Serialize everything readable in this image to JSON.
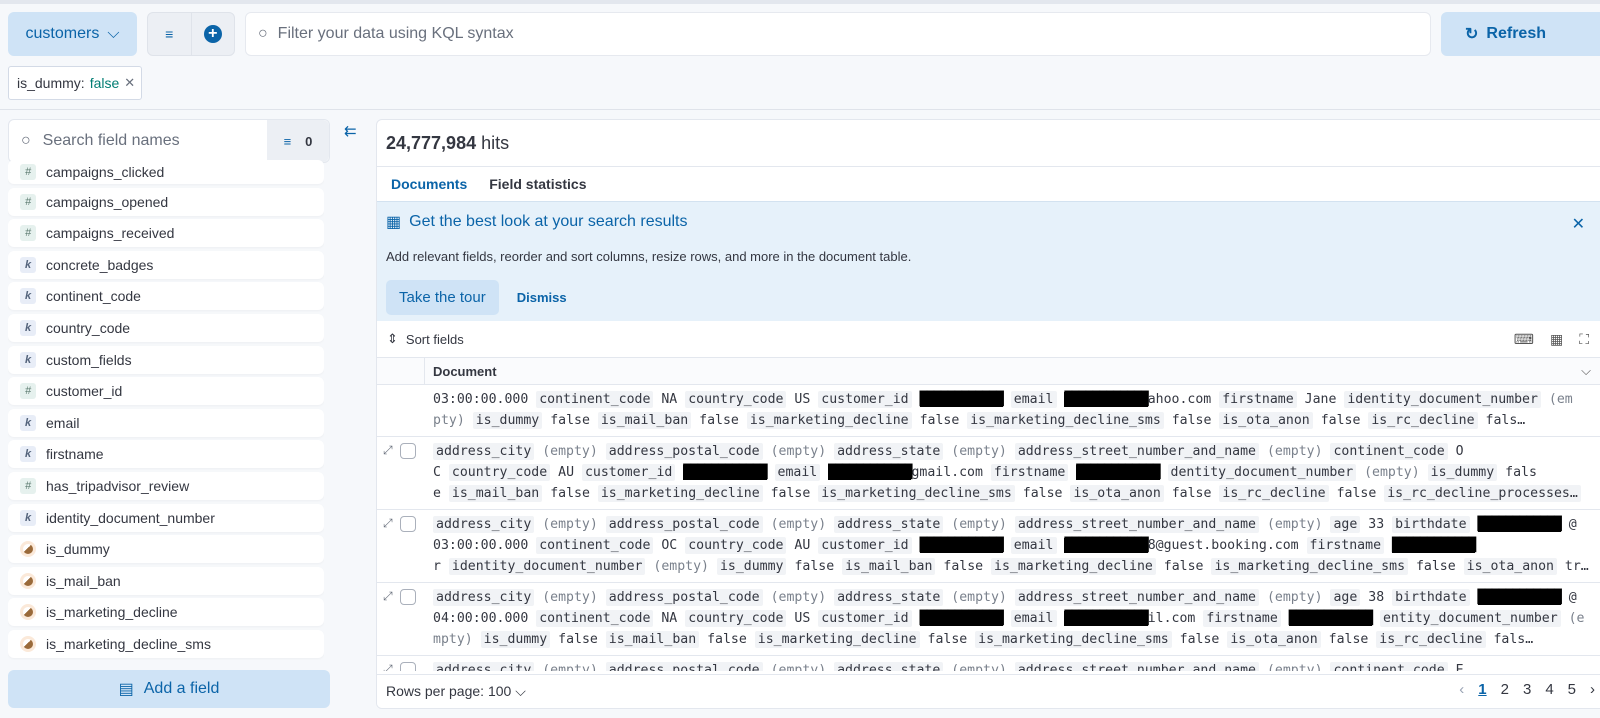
{
  "top": {
    "index_label": "customers",
    "kql_placeholder": "Filter your data using KQL syntax",
    "refresh_label": "Refresh"
  },
  "filter_pill": {
    "field": "is_dummy:",
    "value": "false"
  },
  "sidebar": {
    "search_placeholder": "Search field names",
    "filter_count": "0",
    "fields": [
      {
        "type": "number",
        "name": "campaigns_clicked"
      },
      {
        "type": "number",
        "name": "campaigns_opened"
      },
      {
        "type": "number",
        "name": "campaigns_received"
      },
      {
        "type": "keyword",
        "name": "concrete_badges"
      },
      {
        "type": "keyword",
        "name": "continent_code"
      },
      {
        "type": "keyword",
        "name": "country_code"
      },
      {
        "type": "keyword",
        "name": "custom_fields"
      },
      {
        "type": "number",
        "name": "customer_id"
      },
      {
        "type": "keyword",
        "name": "email"
      },
      {
        "type": "keyword",
        "name": "firstname"
      },
      {
        "type": "number",
        "name": "has_tripadvisor_review"
      },
      {
        "type": "keyword",
        "name": "identity_document_number"
      },
      {
        "type": "boolean",
        "name": "is_dummy"
      },
      {
        "type": "boolean",
        "name": "is_mail_ban"
      },
      {
        "type": "boolean",
        "name": "is_marketing_decline"
      },
      {
        "type": "boolean",
        "name": "is_marketing_decline_sms"
      }
    ],
    "add_field_label": "Add a field"
  },
  "main": {
    "hits_count": "24,777,984",
    "hits_label": "hits",
    "tabs": [
      "Documents",
      "Field statistics"
    ],
    "callout": {
      "title": "Get the best look at your search results",
      "text": "Add relevant fields, reorder and sort columns, resize rows, and more in the document table.",
      "tour_label": "Take the tour",
      "dismiss_label": "Dismiss"
    },
    "sort_label": "Sort fields",
    "column_header": "Document",
    "rows": [
      {
        "controls": false,
        "lines": [
          [
            [
              "v",
              "03:00:00.000"
            ],
            [
              "k",
              "continent_code"
            ],
            [
              "v",
              "NA"
            ],
            [
              "k",
              "country_code"
            ],
            [
              "v",
              "US"
            ],
            [
              "k",
              "customer_id"
            ],
            [
              "r",
              "████████████"
            ],
            [
              "k",
              "email"
            ],
            [
              "r",
              "████████████"
            ],
            [
              "v",
              "ahoo.com"
            ],
            [
              "k",
              "firstname"
            ],
            [
              "v",
              "Jane"
            ],
            [
              "k",
              "identity_document_number"
            ],
            [
              "e",
              "(em"
            ]
          ],
          [
            [
              "e",
              "pty)"
            ],
            [
              "k",
              "is_dummy"
            ],
            [
              "v",
              "false"
            ],
            [
              "k",
              "is_mail_ban"
            ],
            [
              "v",
              "false"
            ],
            [
              "k",
              "is_marketing_decline"
            ],
            [
              "v",
              "false"
            ],
            [
              "k",
              "is_marketing_decline_sms"
            ],
            [
              "v",
              "false"
            ],
            [
              "k",
              "is_ota_anon"
            ],
            [
              "v",
              "false"
            ],
            [
              "k",
              "is_rc_decline"
            ],
            [
              "v",
              "fals…"
            ]
          ]
        ]
      },
      {
        "controls": true,
        "lines": [
          [
            [
              "k",
              "address_city"
            ],
            [
              "e",
              "(empty)"
            ],
            [
              "k",
              "address_postal_code"
            ],
            [
              "e",
              "(empty)"
            ],
            [
              "k",
              "address_state"
            ],
            [
              "e",
              "(empty)"
            ],
            [
              "k",
              "address_street_number_and_name"
            ],
            [
              "e",
              "(empty)"
            ],
            [
              "k",
              "continent_code"
            ],
            [
              "v",
              "O"
            ]
          ],
          [
            [
              "v",
              "C"
            ],
            [
              "k",
              "country_code"
            ],
            [
              "v",
              "AU"
            ],
            [
              "k",
              "customer_id"
            ],
            [
              "r",
              "████████████"
            ],
            [
              "k",
              "email"
            ],
            [
              "r",
              "████████████"
            ],
            [
              "v",
              "gmail.com"
            ],
            [
              "k",
              "firstname"
            ],
            [
              "r",
              "████████████"
            ],
            [
              "k",
              "dentity_document_number"
            ],
            [
              "e",
              "(empty)"
            ],
            [
              "k",
              "is_dummy"
            ],
            [
              "v",
              "fals"
            ]
          ],
          [
            [
              "v",
              "e"
            ],
            [
              "k",
              "is_mail_ban"
            ],
            [
              "v",
              "false"
            ],
            [
              "k",
              "is_marketing_decline"
            ],
            [
              "v",
              "false"
            ],
            [
              "k",
              "is_marketing_decline_sms"
            ],
            [
              "v",
              "false"
            ],
            [
              "k",
              "is_ota_anon"
            ],
            [
              "v",
              "false"
            ],
            [
              "k",
              "is_rc_decline"
            ],
            [
              "v",
              "false"
            ],
            [
              "k",
              "is_rc_decline_processes…"
            ]
          ]
        ]
      },
      {
        "controls": true,
        "lines": [
          [
            [
              "k",
              "address_city"
            ],
            [
              "e",
              "(empty)"
            ],
            [
              "k",
              "address_postal_code"
            ],
            [
              "e",
              "(empty)"
            ],
            [
              "k",
              "address_state"
            ],
            [
              "e",
              "(empty)"
            ],
            [
              "k",
              "address_street_number_and_name"
            ],
            [
              "e",
              "(empty)"
            ],
            [
              "k",
              "age"
            ],
            [
              "v",
              "33"
            ],
            [
              "k",
              "birthdate"
            ],
            [
              "r",
              "████████████"
            ],
            [
              "v",
              "@"
            ]
          ],
          [
            [
              "v",
              "03:00:00.000"
            ],
            [
              "k",
              "continent_code"
            ],
            [
              "v",
              "OC"
            ],
            [
              "k",
              "country_code"
            ],
            [
              "v",
              "AU"
            ],
            [
              "k",
              "customer_id"
            ],
            [
              "r",
              "████████████"
            ],
            [
              "k",
              "email"
            ],
            [
              "r",
              "████████████"
            ],
            [
              "v",
              "8@guest.booking.com"
            ],
            [
              "k",
              "firstname"
            ],
            [
              "r",
              "████████████"
            ]
          ],
          [
            [
              "v",
              "r"
            ],
            [
              "k",
              "identity_document_number"
            ],
            [
              "e",
              "(empty)"
            ],
            [
              "k",
              "is_dummy"
            ],
            [
              "v",
              "false"
            ],
            [
              "k",
              "is_mail_ban"
            ],
            [
              "v",
              "false"
            ],
            [
              "k",
              "is_marketing_decline"
            ],
            [
              "v",
              "false"
            ],
            [
              "k",
              "is_marketing_decline_sms"
            ],
            [
              "v",
              "false"
            ],
            [
              "k",
              "is_ota_anon"
            ],
            [
              "v",
              "tr…"
            ]
          ]
        ]
      },
      {
        "controls": true,
        "lines": [
          [
            [
              "k",
              "address_city"
            ],
            [
              "e",
              "(empty)"
            ],
            [
              "k",
              "address_postal_code"
            ],
            [
              "e",
              "(empty)"
            ],
            [
              "k",
              "address_state"
            ],
            [
              "e",
              "(empty)"
            ],
            [
              "k",
              "address_street_number_and_name"
            ],
            [
              "e",
              "(empty)"
            ],
            [
              "k",
              "age"
            ],
            [
              "v",
              "38"
            ],
            [
              "k",
              "birthdate"
            ],
            [
              "r",
              "████████████"
            ],
            [
              "v",
              "@"
            ]
          ],
          [
            [
              "v",
              "04:00:00.000"
            ],
            [
              "k",
              "continent_code"
            ],
            [
              "v",
              "NA"
            ],
            [
              "k",
              "country_code"
            ],
            [
              "v",
              "US"
            ],
            [
              "k",
              "customer_id"
            ],
            [
              "r",
              "████████████"
            ],
            [
              "k",
              "email"
            ],
            [
              "r",
              "████████████"
            ],
            [
              "v",
              "il.com"
            ],
            [
              "k",
              "firstname"
            ],
            [
              "r",
              "████████████"
            ],
            [
              "k",
              "entity_document_number"
            ],
            [
              "e",
              "(e"
            ]
          ],
          [
            [
              "e",
              "mpty)"
            ],
            [
              "k",
              "is_dummy"
            ],
            [
              "v",
              "false"
            ],
            [
              "k",
              "is_mail_ban"
            ],
            [
              "v",
              "false"
            ],
            [
              "k",
              "is_marketing_decline"
            ],
            [
              "v",
              "false"
            ],
            [
              "k",
              "is_marketing_decline_sms"
            ],
            [
              "v",
              "false"
            ],
            [
              "k",
              "is_ota_anon"
            ],
            [
              "v",
              "false"
            ],
            [
              "k",
              "is_rc_decline"
            ],
            [
              "v",
              "fals…"
            ]
          ]
        ]
      },
      {
        "controls": true,
        "lines": [
          [
            [
              "k",
              "address_city"
            ],
            [
              "e",
              "(empty)"
            ],
            [
              "k",
              "address_postal_code"
            ],
            [
              "e",
              "(empty)"
            ],
            [
              "k",
              "address_state"
            ],
            [
              "e",
              "(empty)"
            ],
            [
              "k",
              "address_street_number_and_name"
            ],
            [
              "e",
              "(empty)"
            ],
            [
              "k",
              "continent_code"
            ],
            [
              "v",
              "E"
            ]
          ]
        ]
      }
    ],
    "footer": {
      "rows_per_page": "Rows per page: 100",
      "pages": [
        "1",
        "2",
        "3",
        "4",
        "5"
      ],
      "current_page": "1"
    }
  },
  "colors": {
    "accent": "#0b64a8",
    "accent_bg": "#cfe3f6",
    "callout_bg": "#e6f1fa"
  }
}
